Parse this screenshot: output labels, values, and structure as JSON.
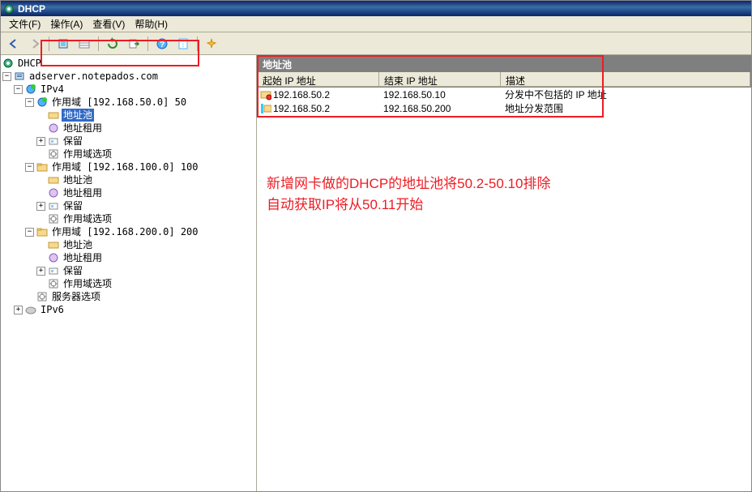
{
  "title": "DHCP",
  "menu": {
    "file": "文件(F)",
    "action": "操作(A)",
    "view": "查看(V)",
    "help": "帮助(H)"
  },
  "tree": {
    "root": "DHCP",
    "server": "adserver.notepados.com",
    "ipv4": "IPv4",
    "scope50": "作用域 [192.168.50.0] 50",
    "pool": "地址池",
    "lease": "地址租用",
    "reservation": "保留",
    "scope_options": "作用域选项",
    "scope100": "作用域 [192.168.100.0] 100",
    "scope200": "作用域 [192.168.200.0] 200",
    "server_options": "服务器选项",
    "ipv6": "IPv6"
  },
  "list": {
    "title": "地址池",
    "col_start": "起始 IP 地址",
    "col_end": "结束 IP 地址",
    "col_desc": "描述",
    "rows": [
      {
        "start": "192.168.50.2",
        "end": "192.168.50.10",
        "desc": "分发中不包括的 IP 地址"
      },
      {
        "start": "192.168.50.2",
        "end": "192.168.50.200",
        "desc": "地址分发范围"
      }
    ]
  },
  "annotation": {
    "line1": "新增网卡做的DHCP的地址池将50.2-50.10排除",
    "line2": "自动获取IP将从50.11开始"
  }
}
